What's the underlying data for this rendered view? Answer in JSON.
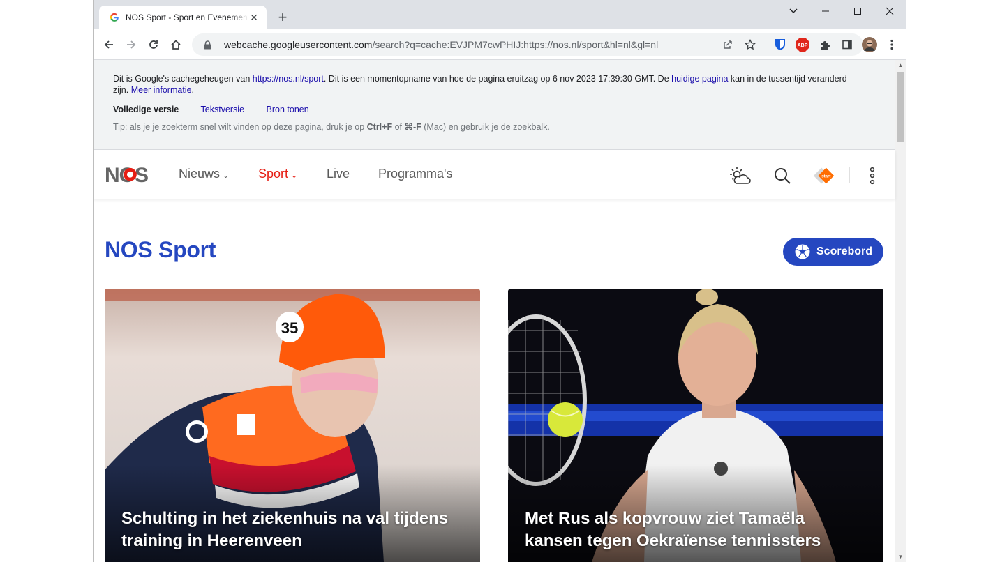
{
  "browser": {
    "tab_title": "NOS Sport - Sport en Evenementen",
    "new_tab": "+",
    "url_host": "webcache.googleusercontent.com",
    "url_path": "/search?q=cache:EVJPM7cwPHIJ:https://nos.nl/sport&hl=nl&gl=nl",
    "extension_abp": "ABP"
  },
  "cache_banner": {
    "text_1": "Dit is Google's cachegeheugen van ",
    "link_url": "https://nos.nl/sport",
    "text_2": ". Dit is een momentopname van hoe de pagina eruitzag op 6 nov 2023 17:39:30 GMT. De ",
    "link_current": "huidige pagina",
    "text_3": " kan in de tussentijd veranderd zijn. ",
    "link_more": "Meer informatie",
    "text_4": ".",
    "full_version": "Volledige versie",
    "text_version": "Tekstversie",
    "show_source": "Bron tonen",
    "tip_1": "Tip: als je je zoekterm snel wilt vinden op deze pagina, druk je op ",
    "tip_key1": "Ctrl+F",
    "tip_2": " of ",
    "tip_key2": "⌘-F",
    "tip_3": " (Mac) en gebruik je de zoekbalk."
  },
  "nos": {
    "logo_text": "NOS",
    "nav": [
      {
        "label": "Nieuws",
        "has_chevron": true
      },
      {
        "label": "Sport",
        "has_chevron": true,
        "active": true
      },
      {
        "label": "Live"
      },
      {
        "label": "Programma's"
      }
    ],
    "chevron": "⌄",
    "npo_badge": "start",
    "page_title": "NOS Sport",
    "scoreboard_label": "Scorebord",
    "colors": {
      "brand_blue": "#2547c0",
      "nos_red": "#e61e14",
      "npo_orange": "#ff6d00"
    }
  },
  "cards": [
    {
      "title": "Schulting in het ziekenhuis na val tijdens training in Heerenveen",
      "helmet_number": "35"
    },
    {
      "title": "Met Rus als kopvrouw ziet Tamaëla kansen tegen Oekraïense tennissters"
    }
  ]
}
